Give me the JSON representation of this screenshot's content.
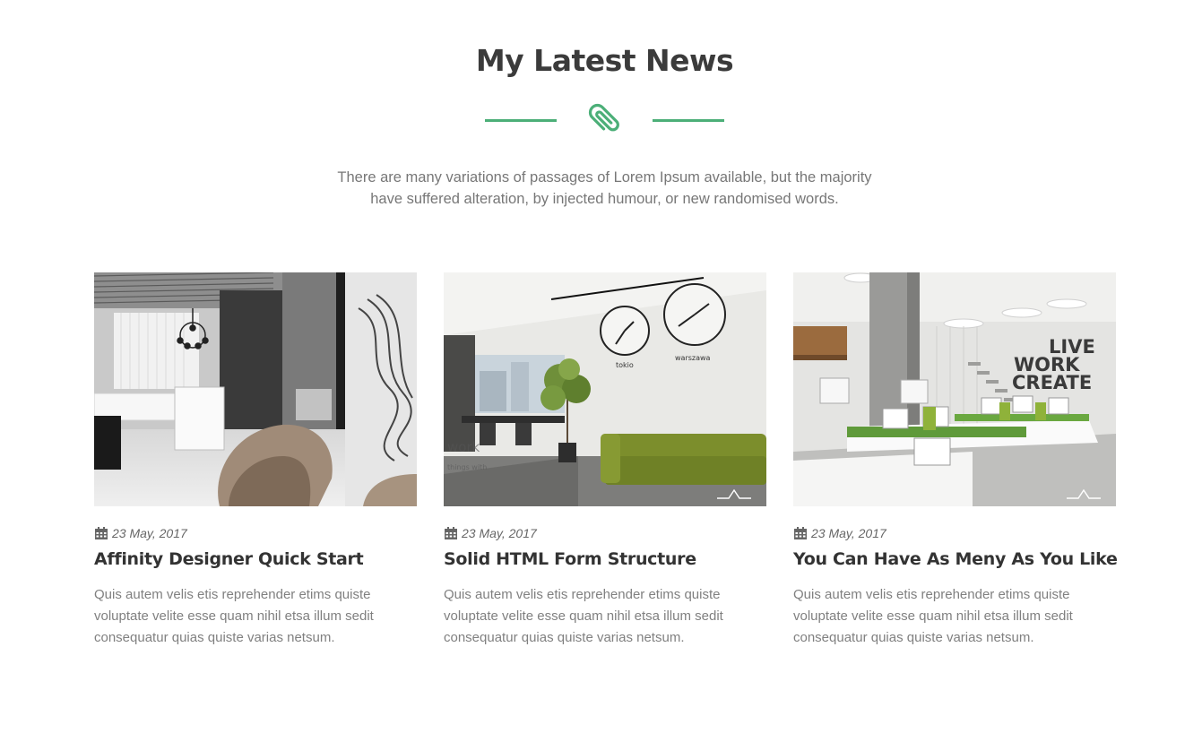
{
  "section": {
    "title": "My Latest News",
    "accent_color": "#4caf78",
    "divider_icon": "paperclip-icon",
    "intro_line1": "There are many variations of passages of Lorem Ipsum available, but the majority",
    "intro_line2": "have suffered alteration, by injected humour, or new randomised words."
  },
  "posts": [
    {
      "date": "23 May, 2017",
      "date_icon": "calendar-icon",
      "title": "Affinity Designer Quick Start",
      "excerpt": "Quis autem velis etis reprehender etims quiste voluptate velite esse quam nihil etsa illum sedit consequatur quias quiste varias netsum.",
      "image": "salon interior with chandelier, reception desk and beige chairs"
    },
    {
      "date": "23 May, 2017",
      "date_icon": "calendar-icon",
      "title": "Solid HTML Form Structure",
      "excerpt": "Quis autem velis etis reprehender etims quiste voluptate velite esse quam nihil etsa illum sedit consequatur quias quiste varias netsum.",
      "image": "lobby with wall clocks, green sofa and potted tree",
      "clock_labels": [
        "tokio",
        "warszawa"
      ]
    },
    {
      "date": "23 May, 2017",
      "date_icon": "calendar-icon",
      "title": "You Can Have As Meny As You Like",
      "excerpt": "Quis autem velis etis reprehender etims quiste voluptate velite esse quam nihil etsa illum sedit consequatur quias quiste varias netsum.",
      "image": "open office with desks, computers and wall lettering",
      "wall_text": [
        "LIVE",
        "WORK",
        "CREATE"
      ]
    }
  ]
}
